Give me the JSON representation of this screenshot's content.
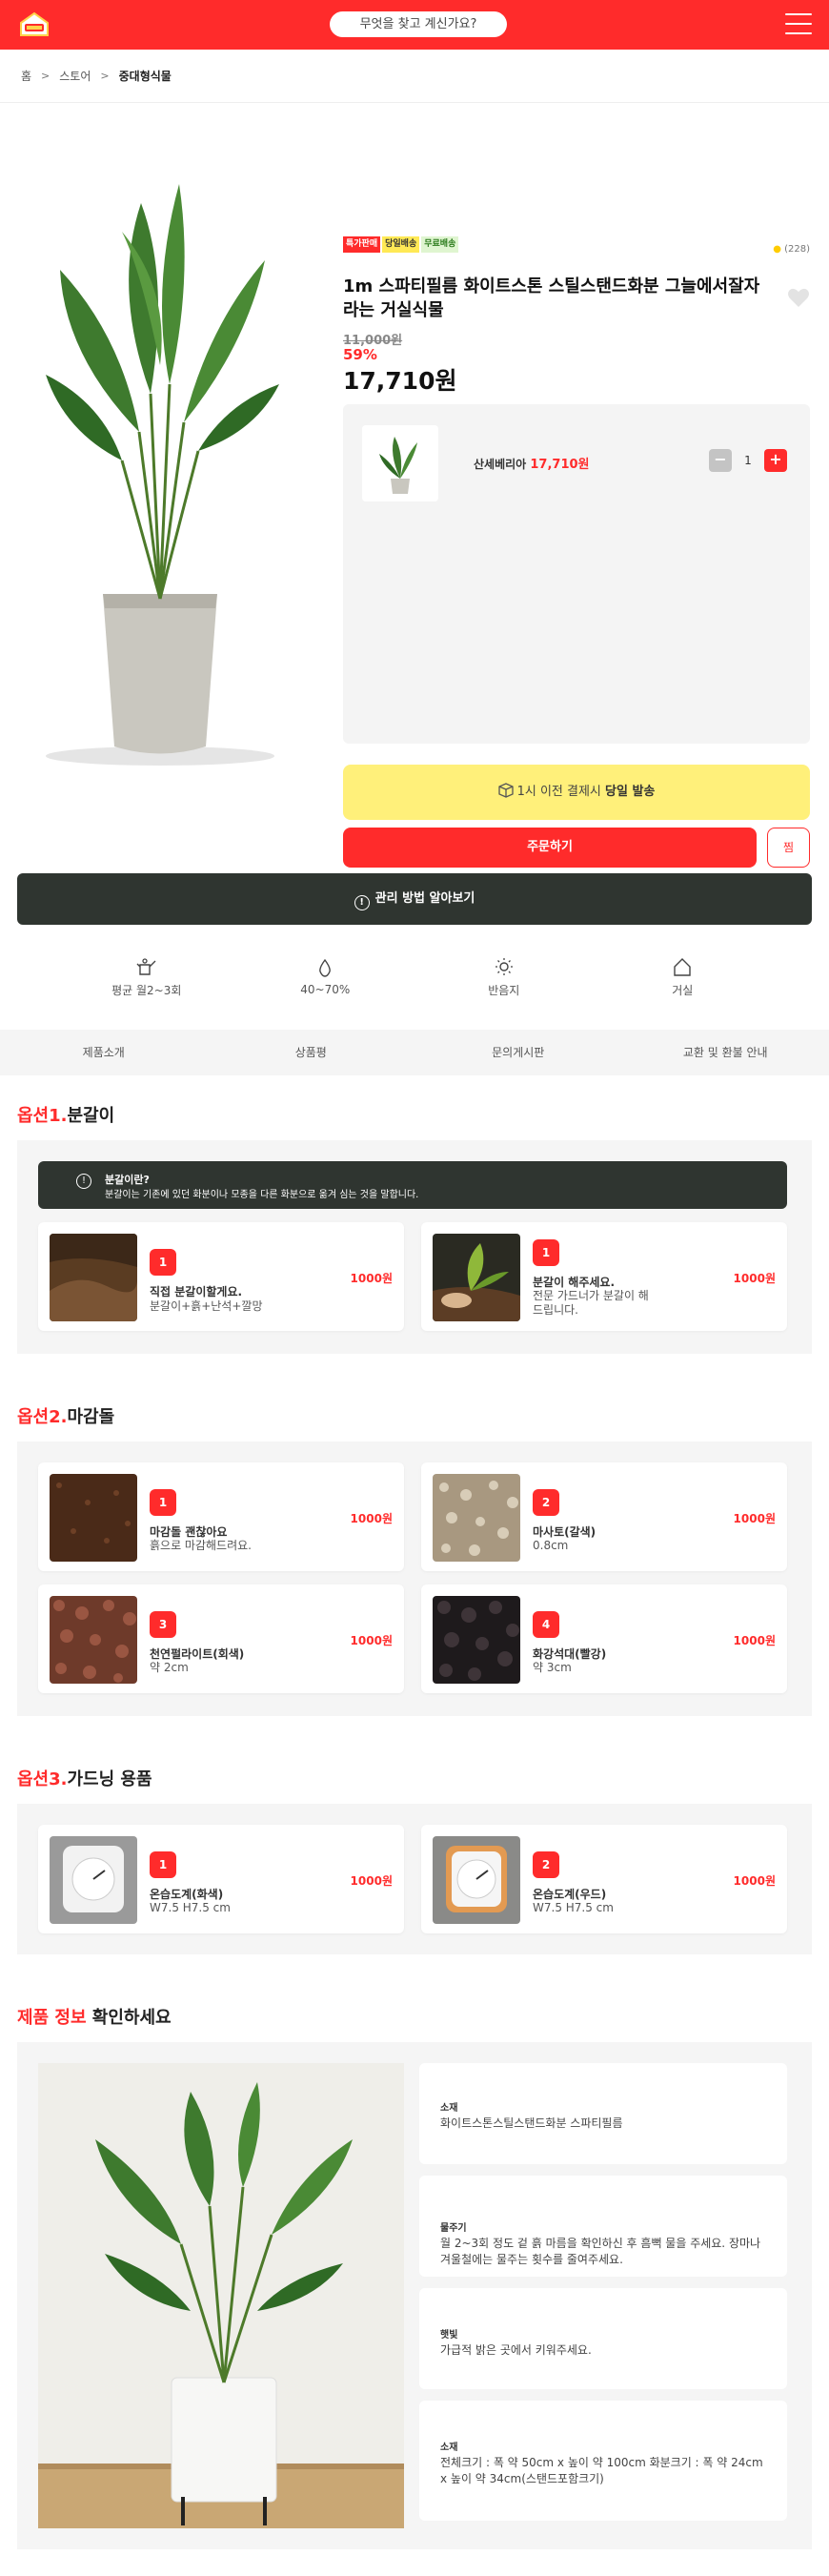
{
  "header": {
    "search_placeholder": "무엇을 찾고 계신가요?",
    "brand_color": "#ff2b2b"
  },
  "breadcrumb": {
    "home": "홈",
    "store": "스토어",
    "current": "중대형식물"
  },
  "product": {
    "badges": [
      "특가판매",
      "당일배송",
      "무료배송"
    ],
    "rating_count": "(228)",
    "title": "1m 스파티필름 화이트스톤 스틸스탠드화분 그늘에서잘자라는 거실식물",
    "old_price": "11,000원",
    "discount": "59%",
    "price": "17,710원",
    "option_name": "산세베리아",
    "option_price": "17,710원",
    "quantity": "1",
    "same_day_prefix": "1시 이전 결제시 ",
    "same_day_bold": "당일 발송",
    "order_label": "주문하기",
    "wish_label": "찜"
  },
  "care_button": "관리 방법 알아보기",
  "stats": [
    {
      "icon": "watering-can-icon",
      "label": "평균 월2~3회"
    },
    {
      "icon": "water-drop-icon",
      "label": "40~70%"
    },
    {
      "icon": "sun-icon",
      "label": "반음지"
    },
    {
      "icon": "house-icon",
      "label": "거실"
    }
  ],
  "tabs": [
    "제품소개",
    "상품평",
    "문의게시판",
    "교환 및 환불 안내"
  ],
  "option1": {
    "title_red": "옵션1.",
    "title": "분갈이",
    "notice_title": "분갈이란?",
    "notice_text": "분갈이는 기존에 있던 화분이나 모종을 다른 화분으로 옮겨 심는 것을 말합니다.",
    "items": [
      {
        "num": "1",
        "title": "직접 분갈이할게요.",
        "sub": "분갈이+흙+난석+깔망",
        "price": "1000원"
      },
      {
        "num": "1",
        "title": "분갈이 해주세요.",
        "sub": "전문 가드너가 분갈이 해드립니다.",
        "price": "1000원"
      }
    ]
  },
  "option2": {
    "title_red": "옵션2.",
    "title": "마감돌",
    "items": [
      {
        "num": "1",
        "title": "마감돌 괜찮아요",
        "sub": "흙으로 마감해드려요.",
        "price": "1000원"
      },
      {
        "num": "2",
        "title": "마사토(갈색)",
        "sub": "0.8cm",
        "price": "1000원"
      },
      {
        "num": "3",
        "title": "천연펄라이트(회색)",
        "sub": "약 2cm",
        "price": "1000원"
      },
      {
        "num": "4",
        "title": "화강석대(빨강)",
        "sub": "약 3cm",
        "price": "1000원"
      }
    ]
  },
  "option3": {
    "title_red": "옵션3.",
    "title": "가드닝 용품",
    "items": [
      {
        "num": "1",
        "title": "온습도계(화색)",
        "sub": "W7.5 H7.5 cm",
        "price": "1000원"
      },
      {
        "num": "2",
        "title": "온습도계(우드)",
        "sub": "W7.5 H7.5 cm",
        "price": "1000원"
      }
    ]
  },
  "product_info": {
    "title_red": "제품 정보",
    "title": " 확인하세요",
    "cards": [
      {
        "label": "소재",
        "value": "화이트스톤스틸스탠드화분 스파티필름"
      },
      {
        "label": "물주기",
        "value": "월 2~3회 정도 겉 흙 마름을 확인하신 후 흠뻑 물을 주세요. 장마나 겨울철에는 물주는 횟수를 줄여주세요."
      },
      {
        "label": "햇빛",
        "value": "가급적 밝은 곳에서 키워주세요."
      },
      {
        "label": "소재",
        "value": "전체크기 : 폭 약 50cm x 높이 약 100cm 화분크기 : 폭 약 24cm x 높이 약 34cm(스탠드포함크기)"
      }
    ]
  }
}
